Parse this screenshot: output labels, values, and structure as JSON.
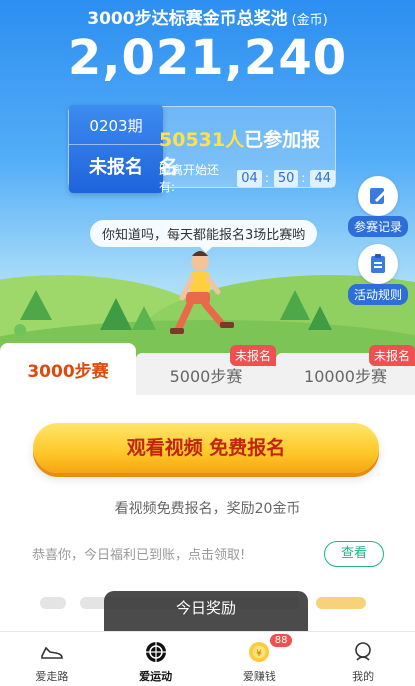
{
  "header": {
    "pool_title": "3000步达标赛金币总奖池",
    "pool_unit": "(金币)",
    "pool_amount": "2,021,240"
  },
  "registration": {
    "period": "0203期",
    "status": "未报名",
    "joined_count": "50531人",
    "joined_text": "已参加报名",
    "countdown_label": "距离开始还有:",
    "countdown": {
      "hh": "04",
      "mm": "50",
      "ss": "44"
    }
  },
  "side_buttons": {
    "records_label": "参赛记录",
    "rules_label": "活动规则"
  },
  "tip_text": "你知道吗，每天都能报名3场比赛哟",
  "tabs": [
    {
      "label": "3000步赛",
      "badge": ""
    },
    {
      "label": "5000步赛",
      "badge": "未报名"
    },
    {
      "label": "10000步赛",
      "badge": "未报名"
    }
  ],
  "main": {
    "cta_label": "观看视频 免费报名",
    "cta_subtitle": "看视频免费报名，奖励20金币",
    "welfare_text": "恭喜你，今日福利已到账，点击领取!",
    "view_button": "查看",
    "toast": "今日奖励"
  },
  "bottom_nav": [
    {
      "label": "爱走路",
      "icon": "shoe-icon",
      "badge": ""
    },
    {
      "label": "爱运动",
      "icon": "ball-icon",
      "badge": ""
    },
    {
      "label": "爱赚钱",
      "icon": "coin-icon",
      "badge": "88"
    },
    {
      "label": "我的",
      "icon": "avatar-icon",
      "badge": ""
    }
  ],
  "colors": {
    "accent": "#e0490a",
    "primary_blue": "#2c6fd8",
    "cta_yellow": "#ffc828",
    "badge_red": "#f05050",
    "view_green": "#1fb487"
  }
}
